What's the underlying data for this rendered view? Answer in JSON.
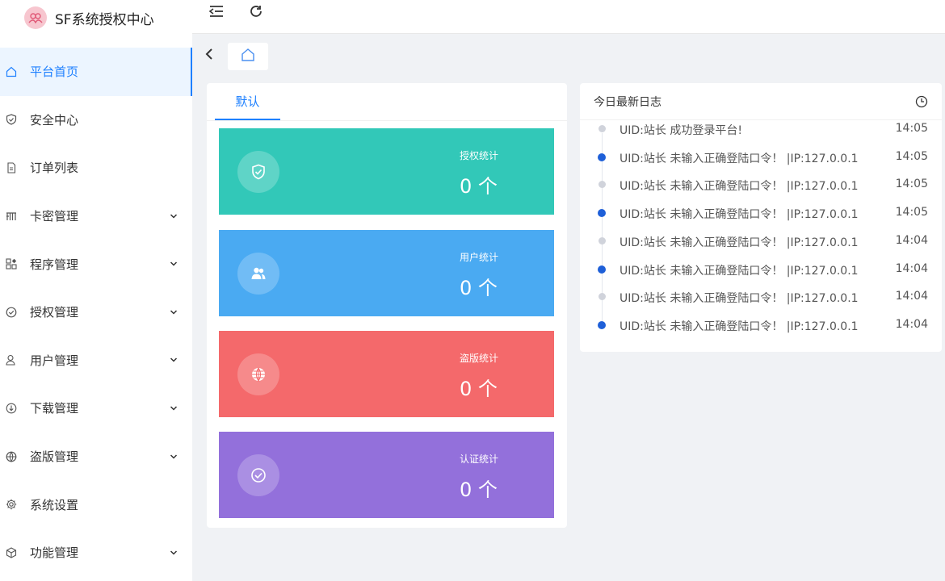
{
  "app": {
    "title": "SF系统授权中心"
  },
  "menu": [
    {
      "label": "平台首页",
      "icon": "home-icon",
      "active": true,
      "expandable": false
    },
    {
      "label": "安全中心",
      "icon": "shield-icon",
      "active": false,
      "expandable": false
    },
    {
      "label": "订单列表",
      "icon": "document-icon",
      "active": false,
      "expandable": false
    },
    {
      "label": "卡密管理",
      "icon": "card-icon",
      "active": false,
      "expandable": true
    },
    {
      "label": "程序管理",
      "icon": "apps-icon",
      "active": false,
      "expandable": true
    },
    {
      "label": "授权管理",
      "icon": "check-circle-icon",
      "active": false,
      "expandable": true
    },
    {
      "label": "用户管理",
      "icon": "user-icon",
      "active": false,
      "expandable": true
    },
    {
      "label": "下载管理",
      "icon": "download-icon",
      "active": false,
      "expandable": true
    },
    {
      "label": "盗版管理",
      "icon": "globe-icon",
      "active": false,
      "expandable": true
    },
    {
      "label": "系统设置",
      "icon": "gear-icon",
      "active": false,
      "expandable": false
    },
    {
      "label": "功能管理",
      "icon": "cube-icon",
      "active": false,
      "expandable": true
    }
  ],
  "main": {
    "tab_label": "默认",
    "cards": [
      {
        "label": "授权统计",
        "value": "0 个",
        "color": "#32c8b8",
        "icon": "shield-check-icon"
      },
      {
        "label": "用户统计",
        "value": "0 个",
        "color": "#4aaaf2",
        "icon": "users-icon"
      },
      {
        "label": "盗版统计",
        "value": "0 个",
        "color": "#f4696b",
        "icon": "globe-icon"
      },
      {
        "label": "认证统计",
        "value": "0 个",
        "color": "#9370db",
        "icon": "check-circle-icon"
      }
    ]
  },
  "logs": {
    "title": "今日最新日志",
    "items": [
      {
        "text": "UID:站长 成功登录平台!",
        "time": "14:05",
        "dot": "gray"
      },
      {
        "text": "UID:站长 未输入正确登陆口令！ |IP:127.0.0.1",
        "time": "14:05",
        "dot": "blue"
      },
      {
        "text": "UID:站长 未输入正确登陆口令！ |IP:127.0.0.1",
        "time": "14:05",
        "dot": "gray"
      },
      {
        "text": "UID:站长 未输入正确登陆口令！ |IP:127.0.0.1",
        "time": "14:05",
        "dot": "blue"
      },
      {
        "text": "UID:站长 未输入正确登陆口令！ |IP:127.0.0.1",
        "time": "14:04",
        "dot": "gray"
      },
      {
        "text": "UID:站长 未输入正确登陆口令！ |IP:127.0.0.1",
        "time": "14:04",
        "dot": "blue"
      },
      {
        "text": "UID:站长 未输入正确登陆口令！ |IP:127.0.0.1",
        "time": "14:04",
        "dot": "gray"
      },
      {
        "text": "UID:站长 未输入正确登陆口令！ |IP:127.0.0.1",
        "time": "14:04",
        "dot": "blue"
      }
    ]
  },
  "colors": {
    "accent": "#1e80ff"
  }
}
